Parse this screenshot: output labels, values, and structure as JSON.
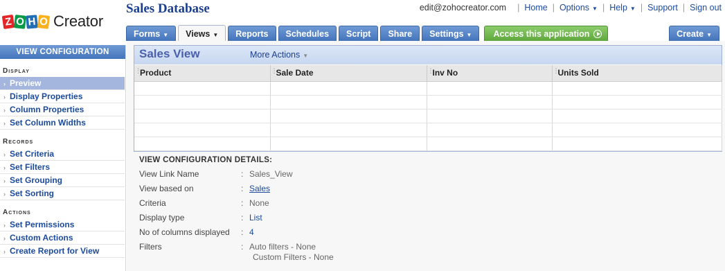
{
  "logo": {
    "letters": [
      "Z",
      "O",
      "H",
      "O"
    ],
    "product": "Creator"
  },
  "app_title": "Sales Database",
  "top_links": {
    "user": "edit@zohocreator.com",
    "items": [
      "Home",
      "Options",
      "Help",
      "Support",
      "Sign out"
    ]
  },
  "tabs": [
    {
      "label": "Forms"
    },
    {
      "label": "Views"
    },
    {
      "label": "Reports"
    },
    {
      "label": "Schedules"
    },
    {
      "label": "Script"
    },
    {
      "label": "Share"
    },
    {
      "label": "Settings"
    }
  ],
  "access_button": "Access this application",
  "create_button": "Create",
  "sidebar": {
    "title": "View Configuration",
    "sections": [
      {
        "title": "Display",
        "items": [
          "Preview",
          "Display Properties",
          "Column Properties",
          "Set Column Widths"
        ]
      },
      {
        "title": "Records",
        "items": [
          "Set Criteria",
          "Set Filters",
          "Set Grouping",
          "Set Sorting"
        ]
      },
      {
        "title": "Actions",
        "items": [
          "Set Permissions",
          "Custom Actions",
          "Create Report for View"
        ]
      }
    ],
    "active_item": "Preview"
  },
  "view": {
    "title": "Sales View",
    "more_actions": "More Actions",
    "columns": [
      "Product",
      "Sale Date",
      "Inv No",
      "Units Sold"
    ]
  },
  "details": {
    "title": "VIEW CONFIGURATION DETAILS:",
    "rows": [
      {
        "label": "View Link Name",
        "value": "Sales_View"
      },
      {
        "label": "View based on",
        "value": "Sales"
      },
      {
        "label": "Criteria",
        "value": "None"
      },
      {
        "label": "Display type",
        "value": "List"
      },
      {
        "label": "No of columns displayed",
        "value": "4"
      },
      {
        "label": "Filters",
        "value": "Auto filters - None",
        "value2": "Custom Filters - None"
      }
    ]
  },
  "colors": {
    "tab_blue": "#4474bb",
    "access_green": "#5ea83d",
    "title_navy": "#1b3f8f",
    "link_blue": "#1b4a9c",
    "sidebar_active": "#a4b6dd"
  }
}
